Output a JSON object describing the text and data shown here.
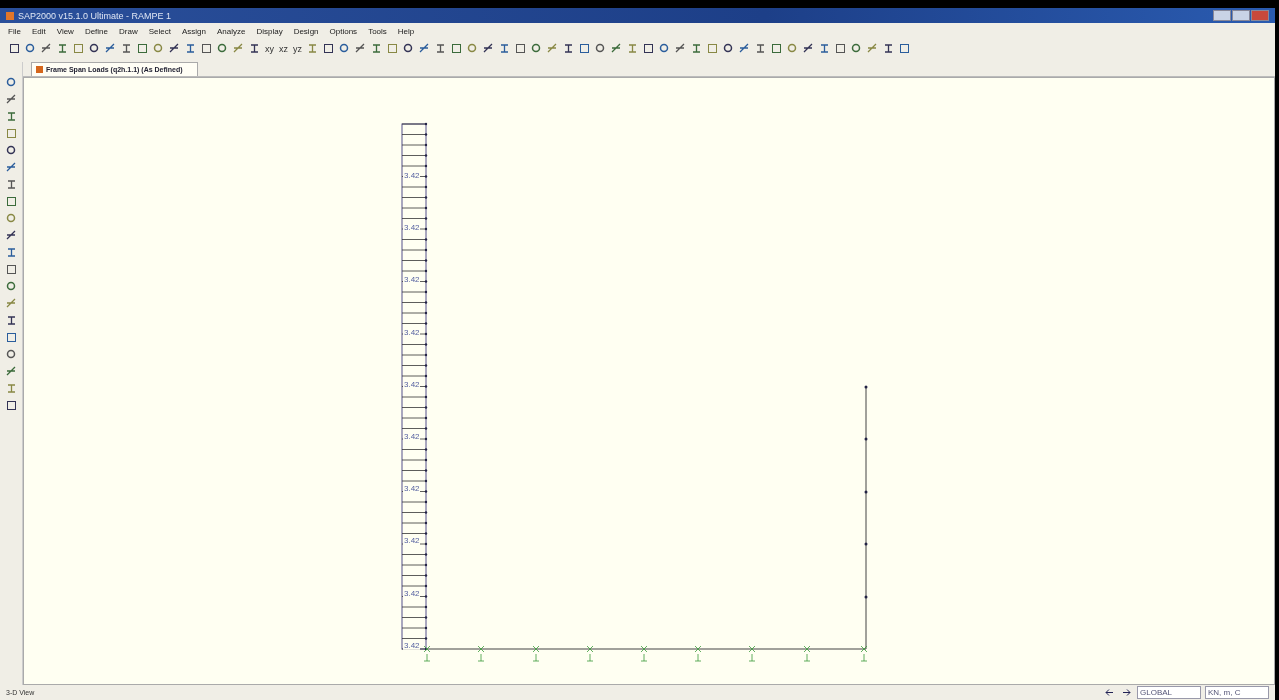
{
  "window": {
    "title": "SAP2000 v15.1.0 Ultimate - RAMPE 1"
  },
  "menu": [
    "File",
    "Edit",
    "View",
    "Define",
    "Draw",
    "Select",
    "Assign",
    "Analyze",
    "Display",
    "Design",
    "Options",
    "Tools",
    "Help"
  ],
  "toolbar": [
    {
      "kind": "icon"
    },
    {
      "kind": "icon"
    },
    {
      "kind": "icon"
    },
    {
      "kind": "icon"
    },
    {
      "kind": "icon"
    },
    {
      "kind": "icon"
    },
    {
      "kind": "icon"
    },
    {
      "kind": "icon"
    },
    {
      "kind": "icon"
    },
    {
      "kind": "icon"
    },
    {
      "kind": "icon"
    },
    {
      "kind": "icon"
    },
    {
      "kind": "icon"
    },
    {
      "kind": "icon"
    },
    {
      "kind": "icon"
    },
    {
      "kind": "icon"
    },
    {
      "kind": "text",
      "label": "xy"
    },
    {
      "kind": "text",
      "label": "xz"
    },
    {
      "kind": "text",
      "label": "yz"
    },
    {
      "kind": "icon"
    },
    {
      "kind": "icon"
    },
    {
      "kind": "icon"
    },
    {
      "kind": "icon"
    },
    {
      "kind": "icon"
    },
    {
      "kind": "icon"
    },
    {
      "kind": "icon"
    },
    {
      "kind": "icon"
    },
    {
      "kind": "icon"
    },
    {
      "kind": "icon"
    },
    {
      "kind": "icon"
    },
    {
      "kind": "icon"
    },
    {
      "kind": "icon"
    },
    {
      "kind": "icon"
    },
    {
      "kind": "icon"
    },
    {
      "kind": "icon"
    },
    {
      "kind": "icon"
    },
    {
      "kind": "icon"
    },
    {
      "kind": "icon"
    },
    {
      "kind": "icon"
    },
    {
      "kind": "icon"
    },
    {
      "kind": "icon"
    },
    {
      "kind": "icon"
    },
    {
      "kind": "icon"
    },
    {
      "kind": "icon"
    },
    {
      "kind": "icon"
    },
    {
      "kind": "icon"
    },
    {
      "kind": "icon"
    },
    {
      "kind": "icon"
    },
    {
      "kind": "icon"
    },
    {
      "kind": "icon"
    },
    {
      "kind": "icon"
    },
    {
      "kind": "icon"
    },
    {
      "kind": "icon"
    },
    {
      "kind": "icon"
    },
    {
      "kind": "icon"
    },
    {
      "kind": "icon"
    },
    {
      "kind": "icon"
    }
  ],
  "tab": {
    "label": "Frame Span Loads (q2h.1.1) (As Defined)",
    "selected": true
  },
  "load_labels": [
    "3.42",
    "3.42",
    "3.42",
    "3.42",
    "3.42",
    "3.42",
    "3.42",
    "3.42",
    "3.42",
    "3.42"
  ],
  "status_bar": {
    "view": "3-D View",
    "coord_system": "GLOBAL",
    "units": "KN, m, C"
  }
}
